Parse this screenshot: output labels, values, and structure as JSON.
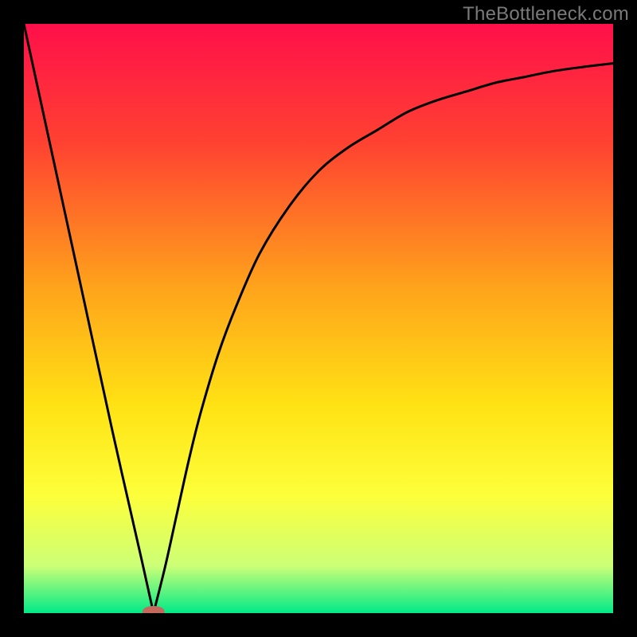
{
  "watermark": "TheBottleneck.com",
  "chart_data": {
    "type": "line",
    "title": "",
    "xlabel": "",
    "ylabel": "",
    "xlim": [
      0,
      100
    ],
    "ylim": [
      0,
      100
    ],
    "grid": false,
    "legend": false,
    "background": {
      "type": "vertical-gradient",
      "stops": [
        {
          "pct": 0,
          "color": "#ff0f4a"
        },
        {
          "pct": 20,
          "color": "#ff4131"
        },
        {
          "pct": 45,
          "color": "#ffa41b"
        },
        {
          "pct": 65,
          "color": "#ffe314"
        },
        {
          "pct": 80,
          "color": "#fdff3a"
        },
        {
          "pct": 92,
          "color": "#ccff77"
        },
        {
          "pct": 100,
          "color": "#00ea87"
        }
      ]
    },
    "marker": {
      "x": 22,
      "y": 0,
      "color": "#c46a5c",
      "shape": "pill"
    },
    "series": [
      {
        "name": "curve",
        "color": "#000000",
        "x": [
          0,
          5,
          10,
          15,
          20,
          22,
          24,
          26,
          28,
          30,
          33,
          36,
          40,
          45,
          50,
          55,
          60,
          65,
          70,
          75,
          80,
          85,
          90,
          95,
          100
        ],
        "y": [
          100,
          77,
          54,
          31,
          9,
          0,
          8,
          17,
          26,
          34,
          44,
          52,
          61,
          69,
          75,
          79,
          82,
          85,
          87,
          88.5,
          90,
          91,
          92,
          92.7,
          93.3
        ]
      }
    ]
  }
}
